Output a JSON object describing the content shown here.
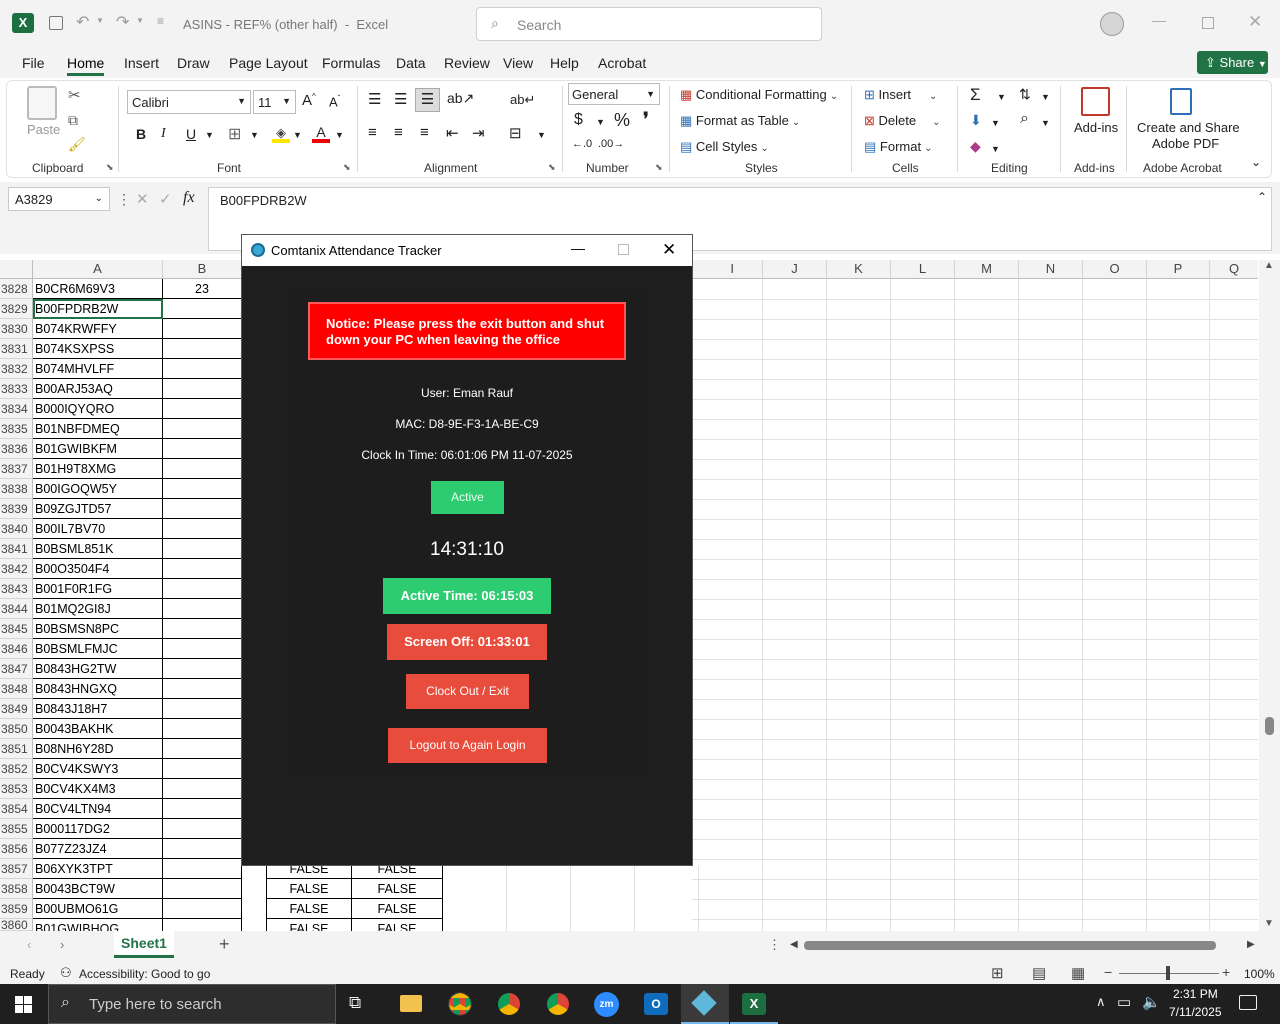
{
  "titlebar": {
    "title": "ASINS - REF% (other half)  -  Excel",
    "search_placeholder": "Search"
  },
  "menu": {
    "file": "File",
    "home": "Home",
    "insert": "Insert",
    "draw": "Draw",
    "page_layout": "Page Layout",
    "formulas": "Formulas",
    "data": "Data",
    "review": "Review",
    "view": "View",
    "help": "Help",
    "acrobat": "Acrobat",
    "share": "Share"
  },
  "ribbon": {
    "paste": "Paste",
    "font_name": "Calibri",
    "font_size": "11",
    "number_format": "General",
    "conditional_formatting": "Conditional Formatting",
    "format_as_table": "Format as Table",
    "cell_styles": "Cell Styles",
    "insert": "Insert",
    "delete": "Delete",
    "format": "Format",
    "addins": "Add-ins",
    "create_share_1": "Create and Share",
    "create_share_2": "Adobe PDF",
    "groups": {
      "clipboard": "Clipboard",
      "font": "Font",
      "alignment": "Alignment",
      "number": "Number",
      "styles": "Styles",
      "cells": "Cells",
      "editing": "Editing",
      "addins": "Add-ins",
      "adobe": "Adobe Acrobat"
    }
  },
  "formula_bar": {
    "name_box": "A3829",
    "formula": "B00FPDRB2W"
  },
  "columns": [
    "A",
    "B",
    "I",
    "J",
    "K",
    "L",
    "M",
    "N",
    "O",
    "P",
    "Q"
  ],
  "rows": [
    {
      "n": "3828",
      "a": "B0CR6M69V3",
      "b": "23"
    },
    {
      "n": "3829",
      "a": "B00FPDRB2W",
      "b": ""
    },
    {
      "n": "3830",
      "a": "B074KRWFFY",
      "b": ""
    },
    {
      "n": "3831",
      "a": "B074KSXPSS",
      "b": ""
    },
    {
      "n": "3832",
      "a": "B074MHVLFF",
      "b": ""
    },
    {
      "n": "3833",
      "a": "B00ARJ53AQ",
      "b": ""
    },
    {
      "n": "3834",
      "a": "B000IQYQRO",
      "b": ""
    },
    {
      "n": "3835",
      "a": "B01NBFDMEQ",
      "b": ""
    },
    {
      "n": "3836",
      "a": "B01GWIBKFM",
      "b": ""
    },
    {
      "n": "3837",
      "a": "B01H9T8XMG",
      "b": ""
    },
    {
      "n": "3838",
      "a": "B00IGOQW5Y",
      "b": ""
    },
    {
      "n": "3839",
      "a": "B09ZGJTD57",
      "b": ""
    },
    {
      "n": "3840",
      "a": "B00IL7BV70",
      "b": ""
    },
    {
      "n": "3841",
      "a": "B0BSML851K",
      "b": ""
    },
    {
      "n": "3842",
      "a": "B00O3504F4",
      "b": ""
    },
    {
      "n": "3843",
      "a": "B001F0R1FG",
      "b": ""
    },
    {
      "n": "3844",
      "a": "B01MQ2GI8J",
      "b": ""
    },
    {
      "n": "3845",
      "a": "B0BSMSN8PC",
      "b": ""
    },
    {
      "n": "3846",
      "a": "B0BSMLFMJC",
      "b": ""
    },
    {
      "n": "3847",
      "a": "B0843HG2TW",
      "b": ""
    },
    {
      "n": "3848",
      "a": "B0843HNGXQ",
      "b": ""
    },
    {
      "n": "3849",
      "a": "B0843J18H7",
      "b": ""
    },
    {
      "n": "3850",
      "a": "B0043BAKHK",
      "b": ""
    },
    {
      "n": "3851",
      "a": "B08NH6Y28D",
      "b": ""
    },
    {
      "n": "3852",
      "a": "B0CV4KSWY3",
      "b": ""
    },
    {
      "n": "3853",
      "a": "B0CV4KX4M3",
      "b": ""
    },
    {
      "n": "3854",
      "a": "B0CV4LTN94",
      "b": ""
    },
    {
      "n": "3855",
      "a": "B000117DG2",
      "b": ""
    },
    {
      "n": "3856",
      "a": "B077Z23JZ4",
      "b": ""
    },
    {
      "n": "3857",
      "a": "B06XYK3TPT",
      "b": "",
      "f1": "FALSE",
      "f2": "FALSE"
    },
    {
      "n": "3858",
      "a": "B0043BCT9W",
      "b": "",
      "f1": "FALSE",
      "f2": "FALSE"
    },
    {
      "n": "3859",
      "a": "B00UBMO61G",
      "b": "",
      "f1": "FALSE",
      "f2": "FALSE"
    },
    {
      "n": "3860",
      "a": "B01GWIBHOG",
      "b": "",
      "f1": "FALSE",
      "f2": "FALSE"
    }
  ],
  "sheet": {
    "tab": "Sheet1",
    "add": "+"
  },
  "status": {
    "ready": "Ready",
    "accessibility": "Accessibility: Good to go",
    "zoom": "100%"
  },
  "dialog": {
    "title": "Comtanix Attendance Tracker",
    "notice": "Notice: Please press the exit button and shut down your PC when leaving the office",
    "user": "User: Eman Rauf",
    "mac": "MAC: D8-9E-F3-1A-BE-C9",
    "clock_in": "Clock In Time: 06:01:06 PM 11-07-2025",
    "status": "Active",
    "clock": "14:31:10",
    "active_time": "Active Time: 06:15:03",
    "screen_off": "Screen Off: 01:33:01",
    "clock_out": "Clock Out / Exit",
    "logout": "Logout to Again Login"
  },
  "taskbar": {
    "search_placeholder": "Type here to search",
    "time": "2:31 PM",
    "date": "7/11/2025"
  },
  "colors": {
    "excel_green": "#217346",
    "active_green": "#2ecc71",
    "red": "#e74c3c",
    "notice_red": "#ff0000"
  }
}
